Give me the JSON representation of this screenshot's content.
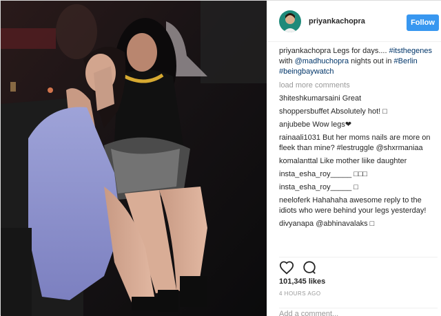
{
  "post": {
    "username": "priyankachopra",
    "follow_label": "Follow",
    "caption": {
      "username": "priyankachopra",
      "text_parts": [
        {
          "text": "Legs for days.... "
        },
        {
          "text": "#itsthegenes",
          "tag": true
        },
        {
          "text": " with "
        },
        {
          "text": "@madhuchopra",
          "tag": true
        },
        {
          "text": " nights out in "
        },
        {
          "text": "#Berlin",
          "tag": true
        },
        {
          "text": " "
        },
        {
          "text": "#beingbaywatch",
          "tag": true
        }
      ]
    },
    "load_more_label": "load more comments",
    "comments": [
      {
        "user": "3hiteshkumarsaini",
        "text": "Great"
      },
      {
        "user": "shoppersbuffet",
        "text": "Absolutely hot! □"
      },
      {
        "user": "anjubebe",
        "text": "Wow legs❤"
      },
      {
        "user": "rainaali1031",
        "text": "But her moms nails are more on fleek than mine? #lestruggle @shxrmaniaa"
      },
      {
        "user": "komalanttal",
        "text": "Like mother liike daughter"
      },
      {
        "user": "insta_esha_roy_____",
        "text": "□□□"
      },
      {
        "user": "insta_esha_roy_____",
        "text": "□"
      },
      {
        "user": "neeloferk",
        "text": "Hahahaha awesome reply to the idiots who were behind your legs yesterday!"
      },
      {
        "user": "divyanapa",
        "text": "@abhinavalaks □"
      }
    ],
    "likes": "101,345 likes",
    "timestamp": "4 HOURS AGO",
    "add_comment_placeholder": "Add a comment..."
  },
  "icons": {
    "like": "heart-icon",
    "comment": "comment-icon"
  },
  "colors": {
    "follow_bg": "#3897f0",
    "tag": "#003569",
    "muted": "#999999"
  }
}
